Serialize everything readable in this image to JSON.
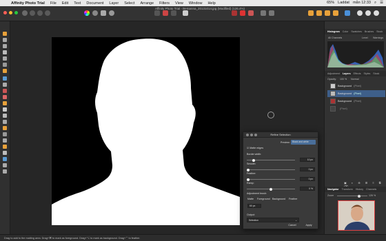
{
  "menubar": {
    "app_name": "Affinity Photo Trial",
    "items": [
      "File",
      "Edit",
      "Text",
      "Document",
      "Layer",
      "Select",
      "Arrange",
      "Filters",
      "View",
      "Window",
      "Help"
    ],
    "battery": "65%",
    "status_right": "Laddat",
    "clock": "mån 12:33"
  },
  "toolbar": {
    "doc_title": "Affinity Photo Trial - Bemanna_20131014.jpg (Modified) (126.4%)"
  },
  "panels": {
    "top_tabs": [
      "Histogram",
      "Color",
      "Swatches",
      "Brushes",
      "Stock"
    ],
    "histogram_sub": [
      "All Channels",
      "Level",
      "Warnings"
    ],
    "layers_tabs": [
      "Adjustment",
      "Layers",
      "Effects",
      "Styles",
      "Stock"
    ],
    "opacity_label": "Opacity:",
    "opacity_value": "100 %",
    "blend_mode": "Normal",
    "layers": [
      {
        "name": "Background",
        "type": "(Pixel)"
      },
      {
        "name": "Background",
        "type": "(Pixel)"
      },
      {
        "name": "Background",
        "type": "(Pixel)"
      },
      {
        "name": "",
        "type": "(Pixel)"
      }
    ],
    "nav_tabs": [
      "Navigator",
      "Transform",
      "History",
      "Channels"
    ],
    "zoom_label": "Zoom",
    "zoom_value": "126 %"
  },
  "dialog": {
    "title": "Refine Selection",
    "preview_label": "Preview:",
    "preview_value": "Black and white",
    "matte_edges": "Matte edges",
    "border_width_label": "Border width:",
    "border_width_value": "10 px",
    "smooth_label": "Smooth:",
    "smooth_value": "0 px",
    "feather_label": "Feather:",
    "feather_value": "0 px",
    "ramp_label": "Ramp:",
    "ramp_value": "0 %",
    "adjustment_brush_label": "Adjustment brush:",
    "brush_buttons": [
      "Matte",
      "Foreground",
      "Background",
      "Feather"
    ],
    "brush_size": "60 px",
    "output_label": "Output:",
    "output_value": "Selection",
    "cancel_label": "Cancel",
    "apply_label": "Apply",
    "sliders": {
      "border_width": 0.12,
      "smooth": 0.0,
      "feather": 0.0,
      "ramp": 0.5
    }
  },
  "status": {
    "hint": "Drag to add to the matting area. Drag+⌘ to mark as foreground. Drag+⌥ to mark as background. Drag+⌃ to feather."
  },
  "colors": {
    "accent": "#4a90d9",
    "selected_row": "#3e5f8a"
  }
}
